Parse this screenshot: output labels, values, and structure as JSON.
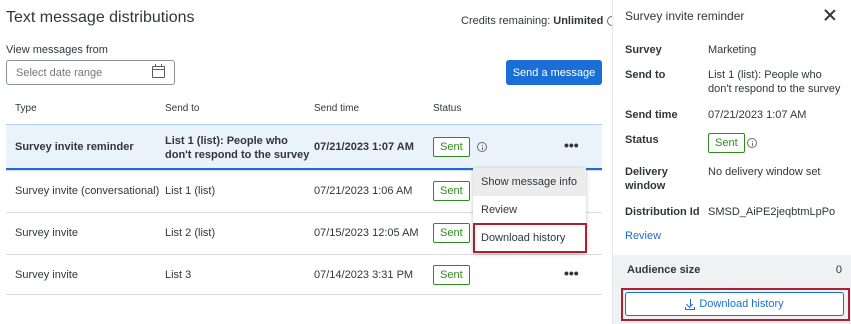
{
  "main": {
    "title": "Text message distributions",
    "credits_label": "Credits remaining:",
    "credits_value": "Unlimited",
    "view_label": "View messages from",
    "date_placeholder": "Select date range",
    "send_button": "Send a message",
    "columns": [
      "Type",
      "Send to",
      "Send time",
      "Status"
    ],
    "rows": [
      {
        "type": "Survey invite reminder",
        "send_to": "List 1 (list): People who don't respond to the survey",
        "send_time": "07/21/2023 1:07 AM",
        "status": "Sent"
      },
      {
        "type": "Survey invite (conversational)",
        "send_to": "List 1 (list)",
        "send_time": "07/21/2023 1:06 AM",
        "status": "Sent"
      },
      {
        "type": "Survey invite",
        "send_to": "List 2 (list)",
        "send_time": "07/15/2023 12:05 AM",
        "status": "Sent"
      },
      {
        "type": "Survey invite",
        "send_to": "List 3",
        "send_time": "07/14/2023 3:31 PM",
        "status": "Sent"
      }
    ],
    "more_glyph": "•••"
  },
  "dropdown": {
    "items": [
      "Show message info",
      "Review",
      "Download history"
    ]
  },
  "side": {
    "title": "Survey invite reminder",
    "survey_label": "Survey",
    "survey_value": "Marketing",
    "send_to_label": "Send to",
    "send_to_value": "List 1 (list): People who don't respond to the survey",
    "send_time_label": "Send time",
    "send_time_value": "07/21/2023 1:07 AM",
    "status_label": "Status",
    "status_value": "Sent",
    "delivery_label": "Delivery window",
    "delivery_value": "No delivery window set",
    "dist_id_label": "Distribution Id",
    "dist_id_value": "SMSD_AiPE2jeqbtmLpPo",
    "review_link": "Review",
    "audience_label": "Audience size",
    "audience_value": "0",
    "download_button": "Download history"
  },
  "colors": {
    "accent": "#1a6ed6",
    "sent_green": "#2e8c1e",
    "highlight_red": "#b01e30",
    "selected_row_bg": "#eaf2fb"
  }
}
